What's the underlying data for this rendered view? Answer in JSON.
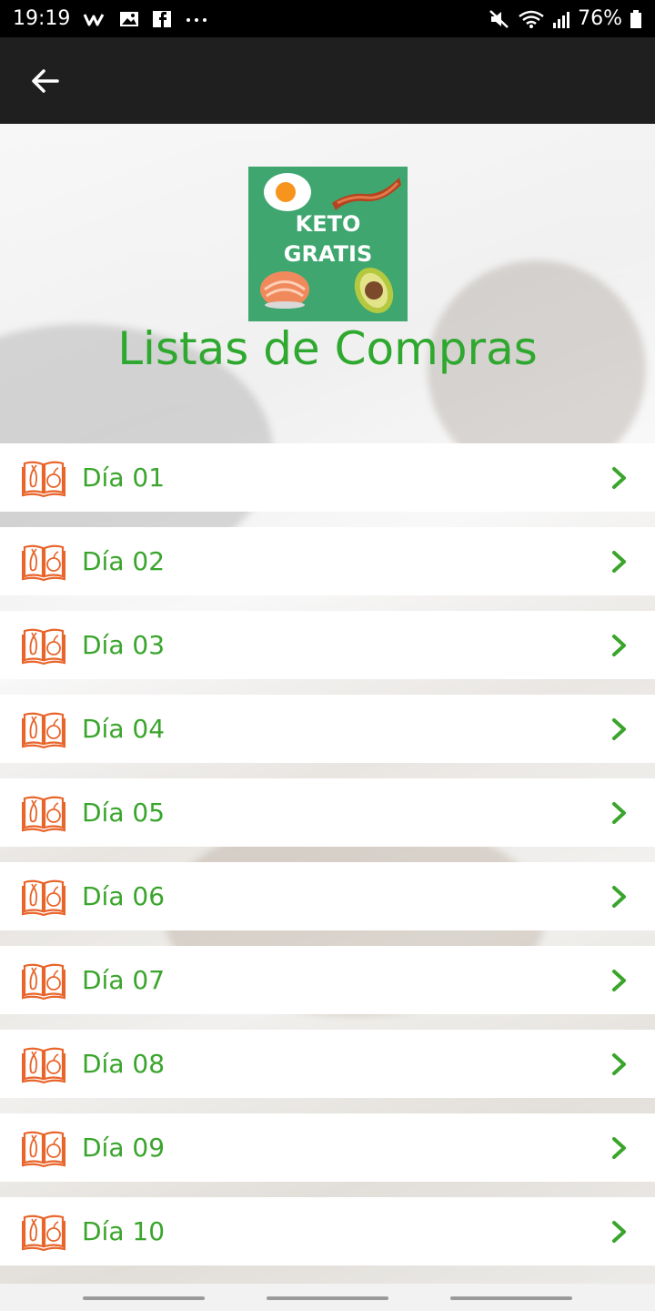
{
  "status_bar": {
    "time": "19:19",
    "battery": "76%",
    "left_icons": [
      "w-app-icon",
      "image-icon",
      "facebook-icon",
      "more-dots-icon"
    ],
    "right_icons": [
      "mute-icon",
      "wifi-icon",
      "signal-icon",
      "battery-icon"
    ]
  },
  "app_bar": {
    "back_icon": "arrow-left-icon"
  },
  "header": {
    "logo_line1": "KETO",
    "logo_line2": "GRATIS",
    "title": "Listas de Compras"
  },
  "list": {
    "items": [
      {
        "label": "Día 01"
      },
      {
        "label": "Día 02"
      },
      {
        "label": "Día 03"
      },
      {
        "label": "Día 04"
      },
      {
        "label": "Día 05"
      },
      {
        "label": "Día 06"
      },
      {
        "label": "Día 07"
      },
      {
        "label": "Día 08"
      },
      {
        "label": "Día 09"
      },
      {
        "label": "Día 10"
      }
    ],
    "item_icon": "recipe-book-icon",
    "chevron_icon": "chevron-right-icon"
  },
  "colors": {
    "accent_green": "#3aa52c",
    "title_green": "#2fa82f",
    "icon_orange": "#e8652b",
    "logo_bg": "#3fa66f",
    "app_bar": "#1f1f1f"
  }
}
